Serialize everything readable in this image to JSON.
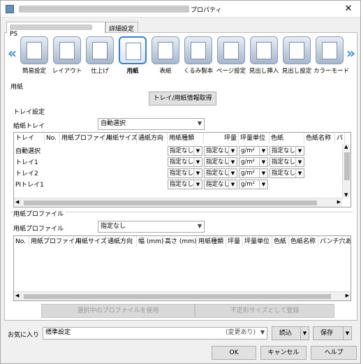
{
  "window": {
    "title": "プロパティ",
    "close_label": "✕"
  },
  "tabs": [
    {
      "label": "PS"
    },
    {
      "label": "詳細設定"
    }
  ],
  "iconbar": {
    "items": [
      {
        "label": "簡易設定"
      },
      {
        "label": "レイアウト"
      },
      {
        "label": "仕上げ"
      },
      {
        "label": "用紙"
      },
      {
        "label": "表紙"
      },
      {
        "label": "くるみ製本"
      },
      {
        "label": "ページ設定"
      },
      {
        "label": "見出し挿入"
      },
      {
        "label": "見出し設定"
      },
      {
        "label": "カラーモード"
      }
    ]
  },
  "paper_section": {
    "title": "用紙",
    "get_info_button": "トレイ/用紙情報取得"
  },
  "tray_section": {
    "title": "トレイ設定",
    "feed_tray_label": "給紙トレイ",
    "feed_tray_value": "自動選択",
    "columns": [
      "トレイ",
      "No.",
      "用紙プロファイル",
      "用紙サイズ",
      "通紙方向",
      "用紙種類",
      "坪量",
      "坪量単位",
      "色紙",
      "色紙名称",
      "パ"
    ],
    "rows": [
      {
        "tray": "自動選択",
        "type": "指定なし",
        "weight": "指定なし",
        "unit": "g/m²",
        "color": "指定なし"
      },
      {
        "tray": "トレイ1",
        "type": "指定なし",
        "weight": "指定なし",
        "unit": "g/m²",
        "color": "指定なし"
      },
      {
        "tray": "トレイ2",
        "type": "指定なし",
        "weight": "指定なし",
        "unit": "g/m²",
        "color": "指定なし"
      },
      {
        "tray": "PIトレイ1",
        "type": "指定なし",
        "weight": "指定なし",
        "unit": "g/m²",
        "color": ""
      }
    ]
  },
  "profile_section": {
    "title": "用紙プロファイル",
    "profile_label": "用紙プロファイル",
    "profile_value": "指定なし",
    "columns": [
      "No.",
      "用紙プロファイル",
      "用紙サイズ",
      "通紙方向",
      "幅 (mm)",
      "高さ (mm)",
      "用紙種類",
      "坪量",
      "坪量単位",
      "色紙",
      "色紙名称",
      "パンチ穴あ"
    ],
    "use_profile_button": "選択中のプロファイルを使用",
    "register_button": "不定形サイズとして登録"
  },
  "footer": {
    "favorites_label": "お気に入り",
    "favorites_value": "標準設定",
    "changed_text": "(変更あり)",
    "load_button": "読込",
    "save_button": "保存",
    "ok_button": "OK",
    "cancel_button": "キャンセル",
    "help_button": "ヘルプ"
  }
}
